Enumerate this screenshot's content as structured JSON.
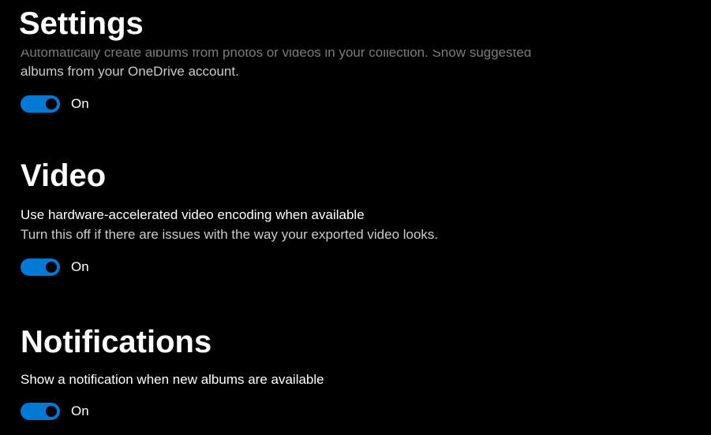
{
  "header": {
    "title": "Settings"
  },
  "albums": {
    "desc_line1": "Automatically create albums from photos or videos in your collection. Show suggested",
    "desc_line2": "albums from your OneDrive account.",
    "toggle_state": "On"
  },
  "video": {
    "heading": "Video",
    "title": "Use hardware-accelerated video encoding when available",
    "desc": "Turn this off if there are issues with the way your exported video looks.",
    "toggle_state": "On"
  },
  "notifications": {
    "heading": "Notifications",
    "title": "Show a notification when new albums are available",
    "toggle_state": "On"
  }
}
